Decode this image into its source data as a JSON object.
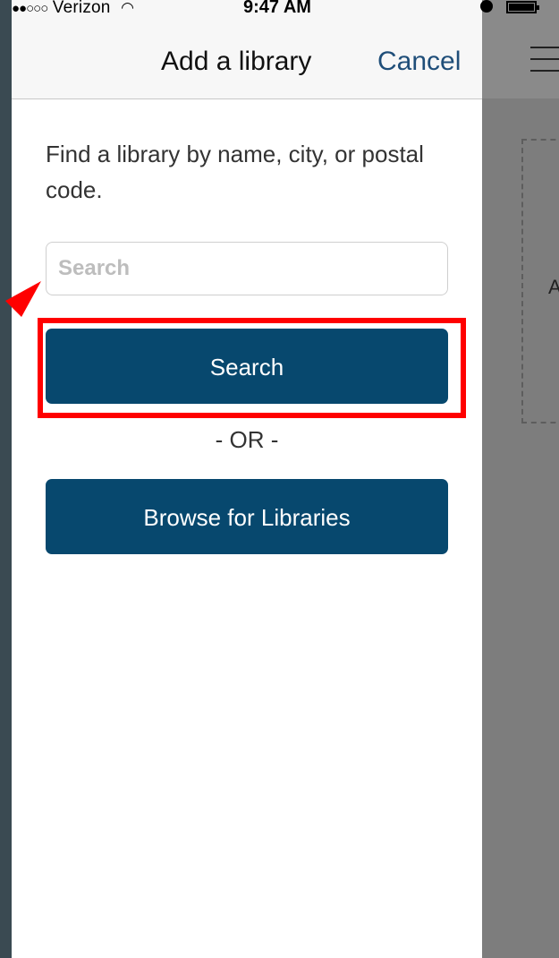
{
  "status_bar": {
    "signal": "●●○○○",
    "carrier": "Verizon",
    "time": "9:47 AM"
  },
  "nav": {
    "title": "Add a library",
    "cancel_label": "Cancel"
  },
  "main": {
    "instructions": "Find a library by name, city, or postal code.",
    "search_placeholder": "Search",
    "search_value": "",
    "search_button_label": "Search",
    "or_separator": "- OR -",
    "browse_button_label": "Browse for Libraries"
  },
  "background_app": {
    "partial_text": "A"
  },
  "colors": {
    "primary_button": "#07486e",
    "link": "#1f4e79",
    "annotation": "#ff0000"
  }
}
